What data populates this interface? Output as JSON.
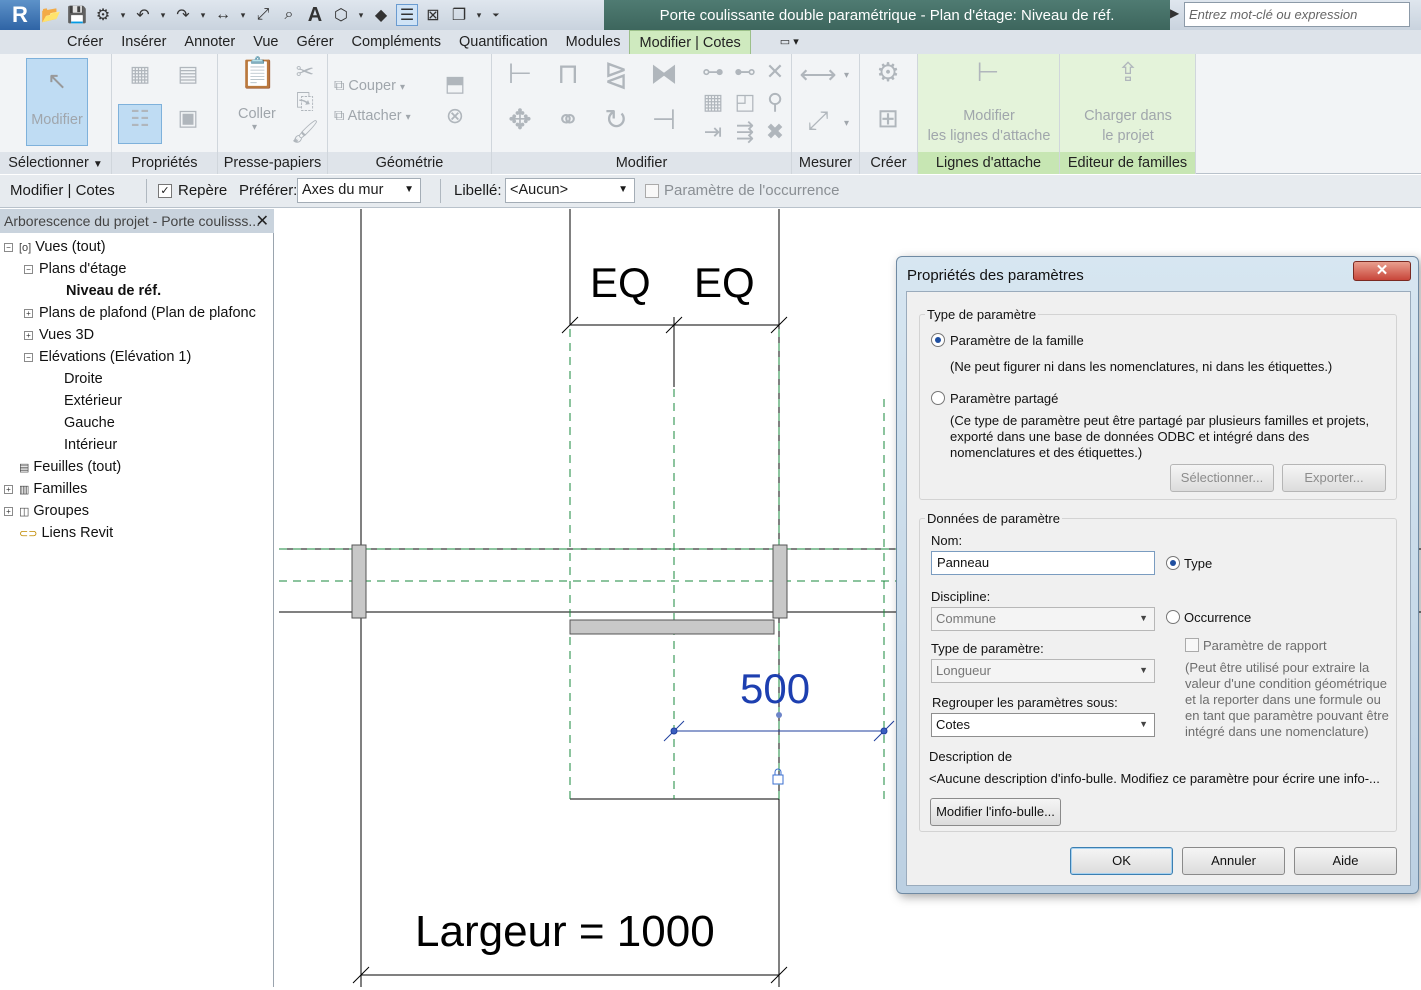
{
  "app": {
    "title": "Porte coulissante double paramétrique - Plan d'étage: Niveau de réf.",
    "search_placeholder": "Entrez mot-clé ou expression"
  },
  "menu_tabs": [
    "Créer",
    "Insérer",
    "Annoter",
    "Vue",
    "Gérer",
    "Compléments",
    "Quantification",
    "Modules",
    "Modifier | Cotes"
  ],
  "ribbon": {
    "modify_label": "Modifier",
    "paste_label": "Coller",
    "cut_label": "Couper",
    "attach_label": "Attacher",
    "modify_leaders_label": "Modifier",
    "modify_leaders_label2": "les lignes d'attache",
    "load_label": "Charger dans",
    "load_label2": "le projet",
    "panels": {
      "select": "Sélectionner",
      "properties": "Propriétés",
      "clipboard": "Presse-papiers",
      "geometry": "Géométrie",
      "modify": "Modifier",
      "measure": "Mesurer",
      "create": "Créer",
      "leaders": "Lignes d'attache",
      "family_editor": "Editeur de familles"
    }
  },
  "options_bar": {
    "context": "Modifier | Cotes",
    "reference_label": "Repère",
    "prefer_label": "Préférer:",
    "prefer_value": "Axes du mur",
    "label_label": "Libellé:",
    "label_value": "<Aucun>",
    "instance_param_label": "Paramètre de l'occurrence"
  },
  "browser": {
    "title": "Arborescence du projet - Porte coulisss...",
    "items": [
      {
        "label": "Vues (tout)",
        "level": 0,
        "toggle": "−"
      },
      {
        "label": "Plans d'étage",
        "level": 1,
        "toggle": "−"
      },
      {
        "label": "Niveau de réf.",
        "level": 2,
        "toggle": "",
        "bold": true
      },
      {
        "label": "Plans de plafond (Plan de plafonc",
        "level": 1,
        "toggle": "+"
      },
      {
        "label": "Vues 3D",
        "level": 1,
        "toggle": "+"
      },
      {
        "label": "Elévations (Elévation 1)",
        "level": 1,
        "toggle": "−"
      },
      {
        "label": "Droite",
        "level": 2,
        "toggle": ""
      },
      {
        "label": "Extérieur",
        "level": 2,
        "toggle": ""
      },
      {
        "label": "Gauche",
        "level": 2,
        "toggle": ""
      },
      {
        "label": "Intérieur",
        "level": 2,
        "toggle": ""
      },
      {
        "label": "Feuilles (tout)",
        "level": 0,
        "toggle": ""
      },
      {
        "label": "Familles",
        "level": 0,
        "toggle": "+"
      },
      {
        "label": "Groupes",
        "level": 0,
        "toggle": "+"
      },
      {
        "label": "Liens Revit",
        "level": 0,
        "toggle": ""
      }
    ]
  },
  "canvas": {
    "eq1": "EQ",
    "eq2": "EQ",
    "dim_value": "500",
    "width_label": "Largeur = 1000"
  },
  "dialog": {
    "title": "Propriétés des paramètres",
    "type_group": "Type de paramètre",
    "family_param": "Paramètre de la famille",
    "family_param_note": "(Ne peut figurer ni dans les nomenclatures, ni dans les étiquettes.)",
    "shared_param": "Paramètre partagé",
    "shared_note_1": "(Ce type de paramètre peut être partagé par plusieurs familles et projets,",
    "shared_note_2": "exporté dans une base de données ODBC et intégré dans des",
    "shared_note_3": "nomenclatures et des étiquettes.)",
    "select_button": "Sélectionner...",
    "export_button": "Exporter...",
    "data_group": "Données de paramètre",
    "name_label": "Nom:",
    "name_value": "Panneau",
    "type_radio": "Type",
    "discipline_label": "Discipline:",
    "discipline_value": "Commune",
    "occurrence_radio": "Occurrence",
    "report_param": "Paramètre de rapport",
    "param_type_label": "Type de paramètre:",
    "param_type_value": "Longueur",
    "report_note_1": "(Peut être utilisé pour extraire la",
    "report_note_2": "valeur d'une condition géométrique",
    "report_note_3": "et la reporter dans une formule ou",
    "report_note_4": "en tant que paramètre pouvant être",
    "report_note_5": "intégré dans une nomenclature)",
    "group_label": "Regrouper les paramètres sous:",
    "group_value": "Cotes",
    "description_label": "Description de",
    "description_value": "<Aucune description d'info-bulle. Modifiez ce paramètre pour écrire une info-...",
    "tooltip_button": "Modifier l'info-bulle...",
    "ok": "OK",
    "cancel": "Annuler",
    "help": "Aide"
  }
}
